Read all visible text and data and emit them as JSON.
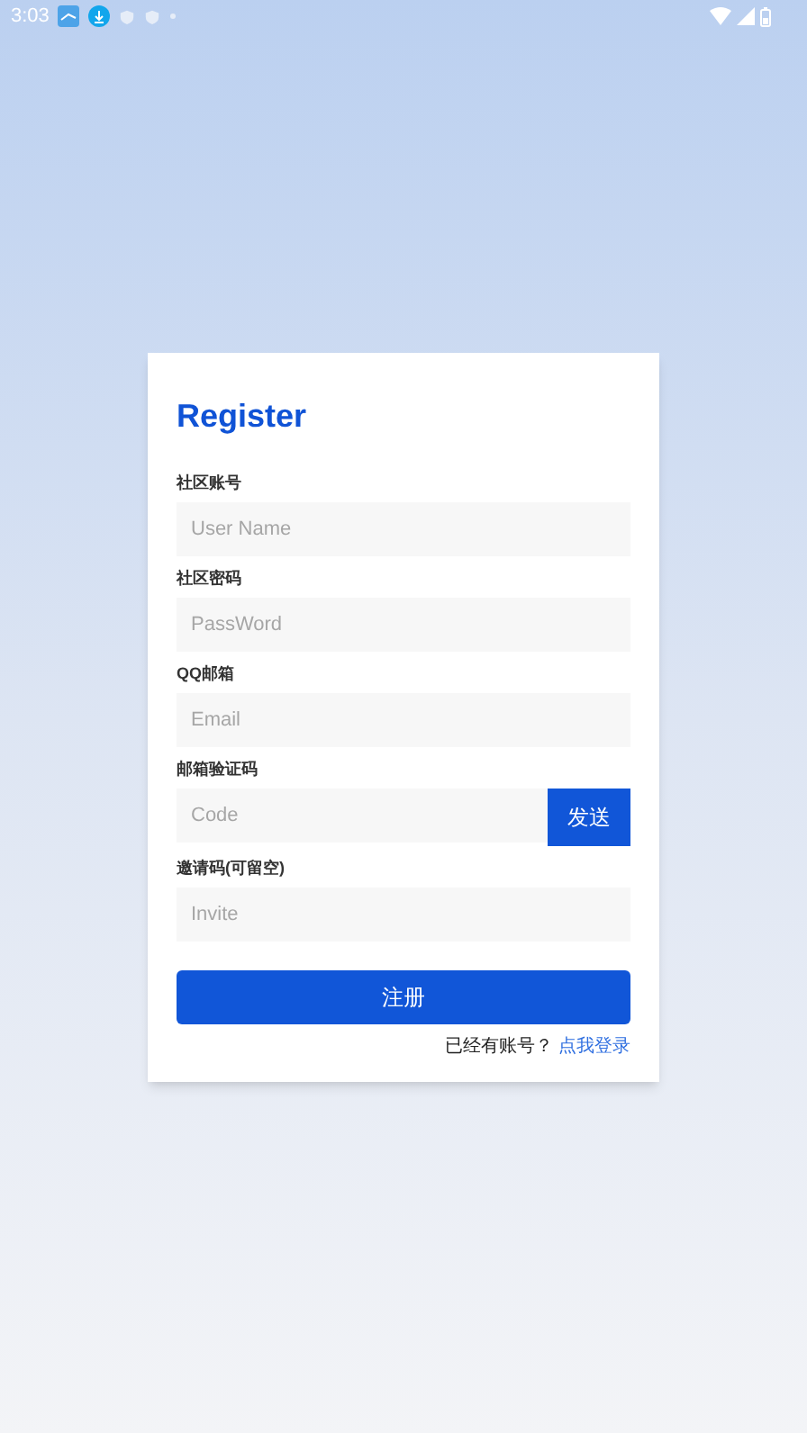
{
  "status_bar": {
    "time": "3:03"
  },
  "title": "Register",
  "fields": [
    {
      "kind": "text",
      "label": "社区账号",
      "placeholder": "User Name"
    },
    {
      "kind": "text",
      "label": "社区密码",
      "placeholder": "PassWord"
    },
    {
      "kind": "text",
      "label": "QQ邮箱",
      "placeholder": "Email"
    },
    {
      "kind": "code",
      "label": "邮箱验证码",
      "placeholder": "Code",
      "button": "发送"
    },
    {
      "kind": "text",
      "label": "邀请码(可留空)",
      "placeholder": "Invite"
    }
  ],
  "submit": "注册",
  "footer": {
    "prompt": "已经有账号？",
    "link": "点我登录"
  }
}
